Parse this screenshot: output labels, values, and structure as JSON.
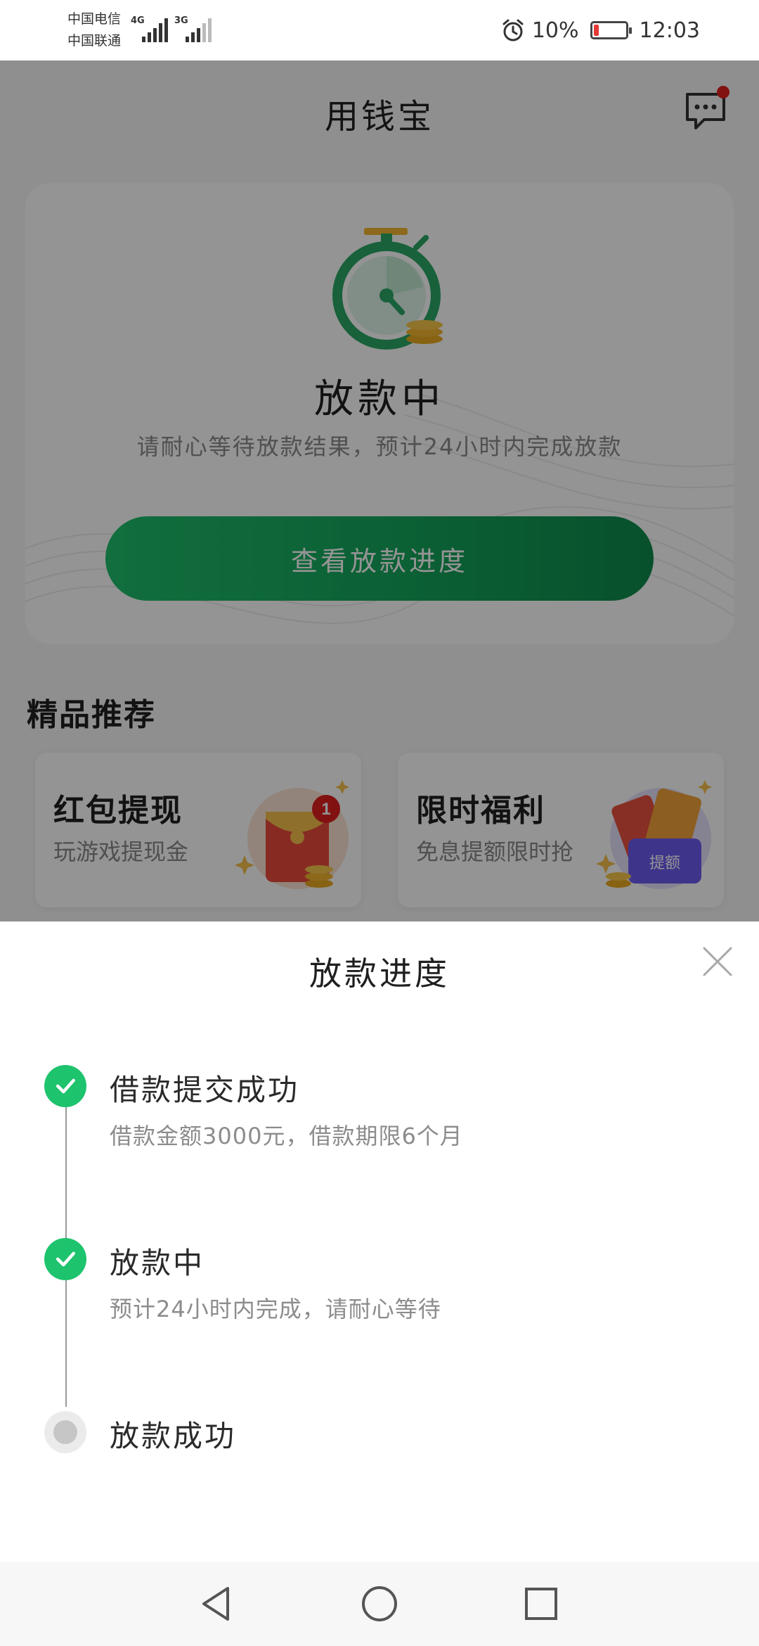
{
  "status_bar": {
    "carrier_1": "中国电信",
    "carrier_2": "中国联通",
    "network_1": "4G",
    "network_2": "3G",
    "battery": "10%",
    "time": "12:03"
  },
  "header": {
    "title": "用钱宝"
  },
  "status_card": {
    "title": "放款中",
    "description": "请耐心等待放款结果，预计24小时内完成放款",
    "button_label": "查看放款进度"
  },
  "recommend": {
    "section_title": "精品推荐",
    "items": [
      {
        "title": "红包提现",
        "subtitle": "玩游戏提现金",
        "badge": "1"
      },
      {
        "title": "限时福利",
        "subtitle": "免息提额限时抢",
        "badge": "提额"
      }
    ]
  },
  "progress_sheet": {
    "title": "放款进度",
    "steps": [
      {
        "title": "借款提交成功",
        "desc": "借款金额3000元，借款期限6个月",
        "status": "done"
      },
      {
        "title": "放款中",
        "desc": "预计24小时内完成，请耐心等待",
        "status": "done"
      },
      {
        "title": "放款成功",
        "desc": "",
        "status": "pending"
      }
    ]
  },
  "colors": {
    "primary_green": "#1ec36d",
    "button_green": "#13a35a",
    "battery_low": "#e53935",
    "badge_red": "#e02020"
  },
  "icons": {
    "alarm": "alarm-icon",
    "message": "message-icon",
    "close": "close-icon",
    "check": "check-icon",
    "nav_back": "back-triangle-icon",
    "nav_home": "home-circle-icon",
    "nav_recent": "recent-square-icon"
  }
}
